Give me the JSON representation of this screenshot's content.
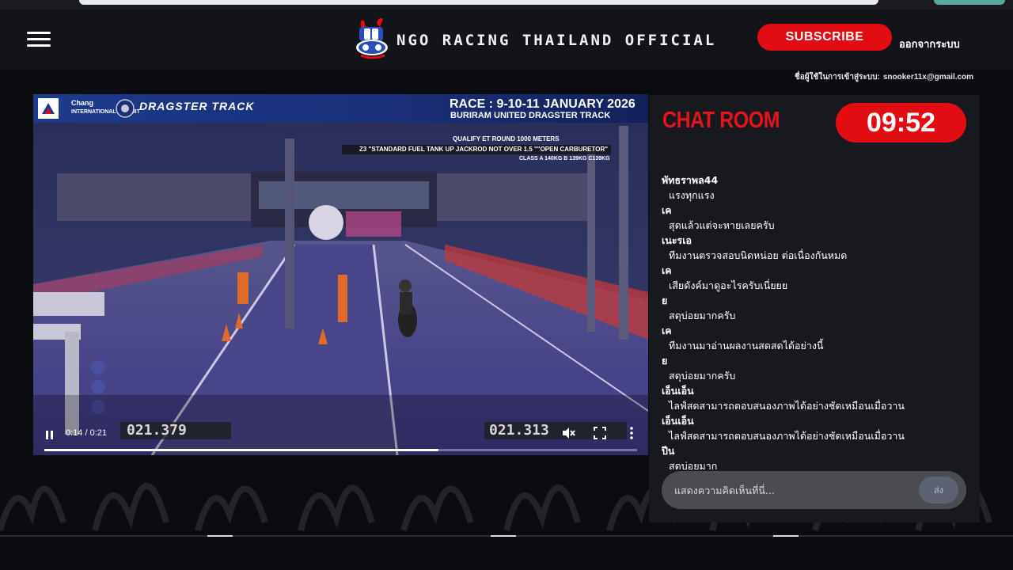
{
  "header": {
    "brand_title": "NGO RACING THAILAND OFFICIAL",
    "subscribe_label": "SUBSCRIBE",
    "logout_label": "ออกจากระบบ",
    "login_label": "ชื่อผู้ใช้ในการเข้าสู่ระบบ:",
    "login_email": "snooker11x@gmail.com"
  },
  "video": {
    "race_title": "RACE : 9-10-11 JANUARY 2026",
    "race_subtitle": "BURIRAM UNITED DRAGSTER TRACK",
    "sponsor_chang": "Chang",
    "sponsor_circuit": "INTERNATIONAL CIRCUIT",
    "sponsor_dragster": "DRAGSTER TRACK",
    "info_row1": "QUALIFY ET ROUND     1000 METERS",
    "info_row2": "Z3 \"STANDARD FUEL TANK UP JACKROD NOT OVER 1.5 \"\"OPEN CARBURETOR\"",
    "info_row3": "CLASS A 140KG B 139KG C139KG",
    "timer_left": "021.379",
    "timer_right": "021.313",
    "time_display": "0:14 / 0:21",
    "progress_fraction": 0.665
  },
  "chat": {
    "title": "CHAT ROOM",
    "countdown": "09:52",
    "messages": [
      {
        "user": "พัทธราพล44",
        "text": "แรงทุกแรง"
      },
      {
        "user": "เค",
        "text": "สุดแล้วแต่จะหายเลยครับ"
      },
      {
        "user": "เนะรเอ",
        "text": "ทีมงานตรวจสอบนิดหน่อย ต่อเนื่องกันหมด"
      },
      {
        "user": "เค",
        "text": "เสียดังค์มาดูอะไรครับเนี่ยยย"
      },
      {
        "user": "ย",
        "text": "สดุบ่อยมากครับ"
      },
      {
        "user": "เค",
        "text": "ทีมงานมาอ่านผลงานสดสดได้อย่างนี้"
      },
      {
        "user": "ย",
        "text": "สดุบ่อยมากครับ"
      },
      {
        "user": "เอ็นเอ็น",
        "text": "ไลฟ์สดสามารถตอบสนองภาพได้อย่างชัดเหมือนเมื่อวาน"
      },
      {
        "user": "เอ็นเอ็น",
        "text": "ไลฟ์สดสามารถตอบสนองภาพได้อย่างชัดเหมือนเมื่อวาน"
      },
      {
        "user": "ปีน",
        "text": "สดุบ่อยมาก"
      }
    ],
    "input_placeholder": "แสดงความคิดเห็นที่นี่...",
    "send_label": "ส่ง"
  },
  "colors": {
    "accent_red": "#e10d13",
    "header_bg": "#121419",
    "chat_bg": "#17191e"
  },
  "icons": [
    "menu-icon",
    "ngo-logo",
    "pause-icon",
    "mute-icon",
    "fullscreen-icon",
    "more-vert-icon"
  ]
}
